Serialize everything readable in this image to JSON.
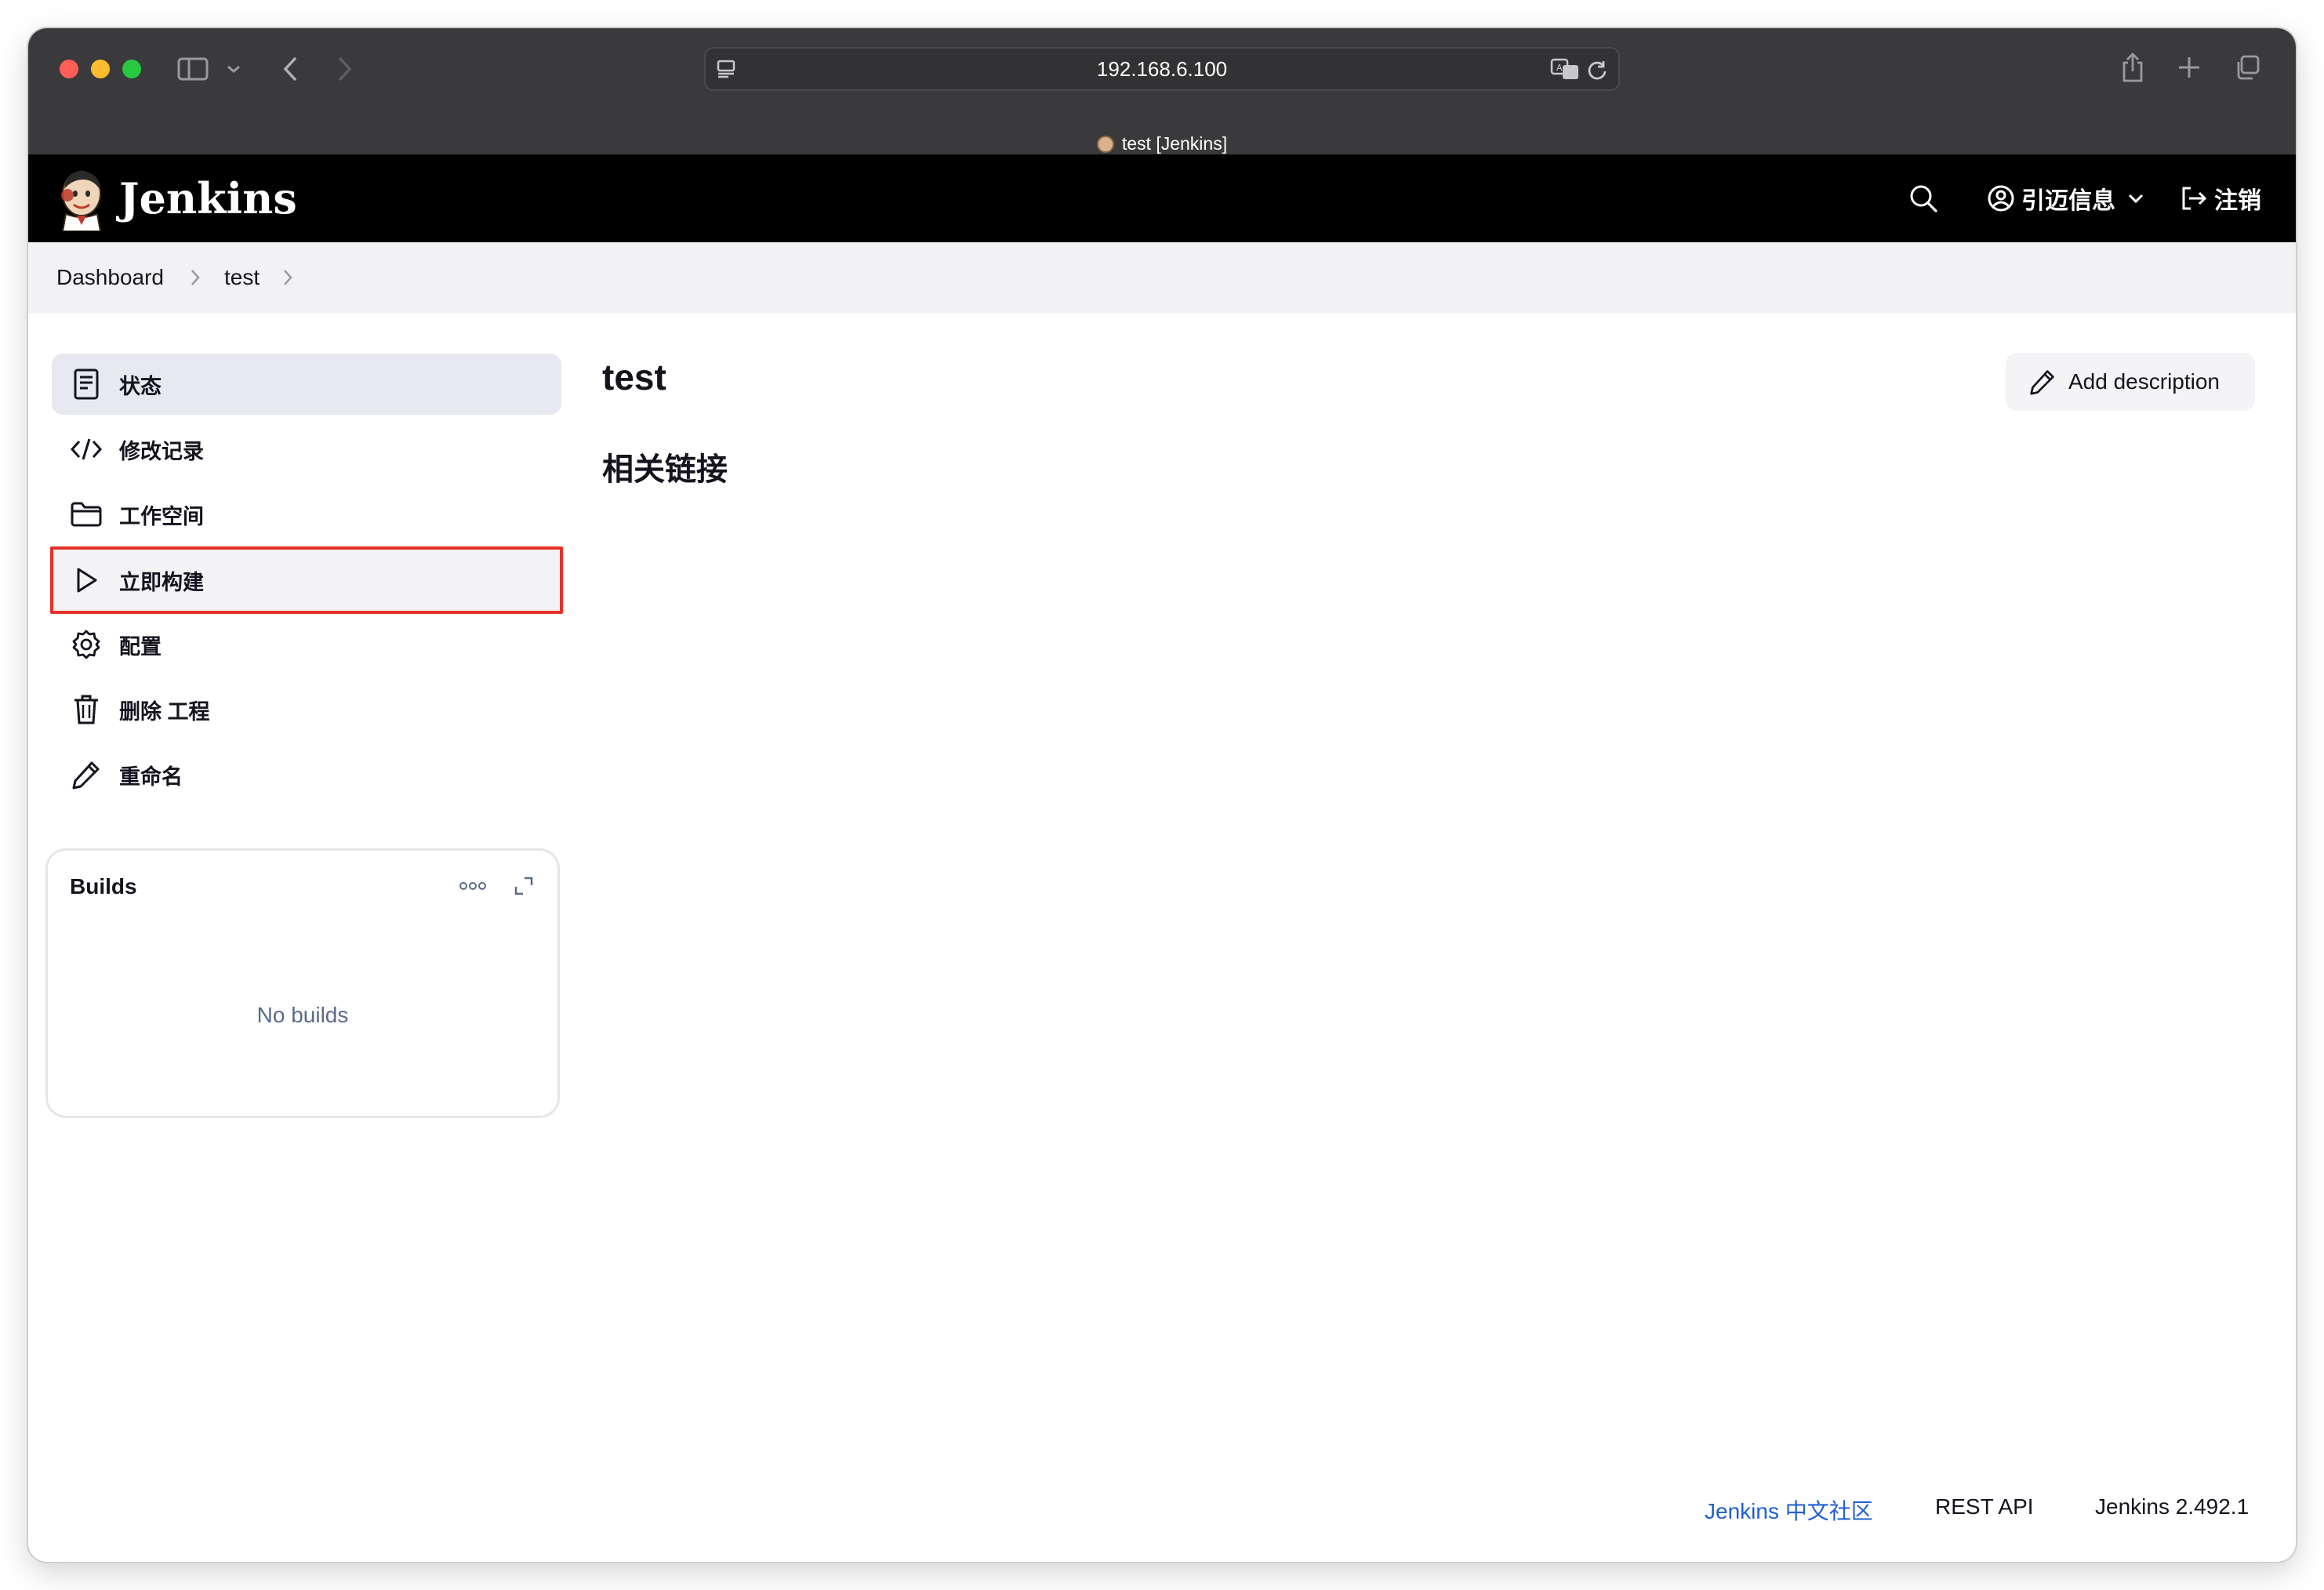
{
  "browser": {
    "url": "192.168.6.100",
    "tab_title": "test [Jenkins]"
  },
  "header": {
    "brand": "Jenkins",
    "user_name": "引迈信息",
    "logout_label": "注销"
  },
  "breadcrumb": {
    "items": [
      "Dashboard",
      "test"
    ]
  },
  "sidebar": {
    "items": [
      {
        "label": "状态",
        "icon": "document-icon"
      },
      {
        "label": "修改记录",
        "icon": "code-icon"
      },
      {
        "label": "工作空间",
        "icon": "folder-icon"
      },
      {
        "label": "立即构建",
        "icon": "play-icon"
      },
      {
        "label": "配置",
        "icon": "gear-icon"
      },
      {
        "label": "删除 工程",
        "icon": "trash-icon"
      },
      {
        "label": "重命名",
        "icon": "pencil-icon"
      }
    ]
  },
  "builds": {
    "title": "Builds",
    "empty_text": "No builds"
  },
  "main": {
    "title": "test",
    "section_title": "相关链接",
    "add_description_label": "Add description"
  },
  "footer": {
    "community_link": "Jenkins 中文社区",
    "rest_api": "REST API",
    "version": "Jenkins 2.492.1"
  },
  "colors": {
    "header_bg": "#000000",
    "highlight_border": "#e5312b",
    "link": "#1f5fd1"
  }
}
